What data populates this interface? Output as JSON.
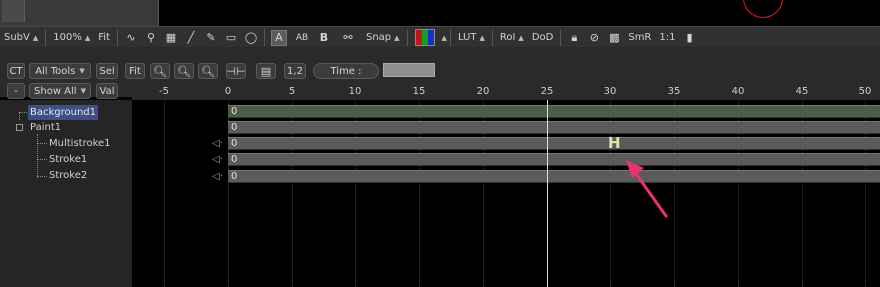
{
  "viewer_toolbar": {
    "subv_label": "SubV",
    "zoom_label": "100%",
    "fit_label": "Fit",
    "snap_label": "Snap",
    "lut_label": "LUT",
    "roi_label": "RoI",
    "dod_label": "DoD",
    "smr_label": "SmR",
    "one_to_one_label": "1:1",
    "text_tool_a": "A",
    "text_tool_ab": "AB",
    "text_tool_b": "B"
  },
  "timeline_controls": {
    "ct_label": "CT",
    "all_tools_label": "All Tools",
    "sel_label": "Sel",
    "fit_label": "Fit",
    "one_two_label": "1,2",
    "time_label": "Time :",
    "minus_label": "-",
    "show_all_label": "Show All",
    "val_label": "Val"
  },
  "ruler": {
    "ticks": [
      "-5",
      "0",
      "5",
      "10",
      "15",
      "20",
      "25",
      "30",
      "35",
      "40",
      "45",
      "50"
    ]
  },
  "tree": {
    "items": [
      "Background1",
      "Paint1",
      "Multistroke1",
      "Stroke1",
      "Stroke2"
    ]
  },
  "tracks": {
    "values": [
      "0",
      "0",
      "0",
      "0",
      "0"
    ],
    "keyframe_marker": "H"
  },
  "colors": {
    "selection": "#3d4f86",
    "playhead": "#e6e6a0",
    "annotation_arrow": "#e8336d",
    "red_circle": "#e01b24"
  }
}
